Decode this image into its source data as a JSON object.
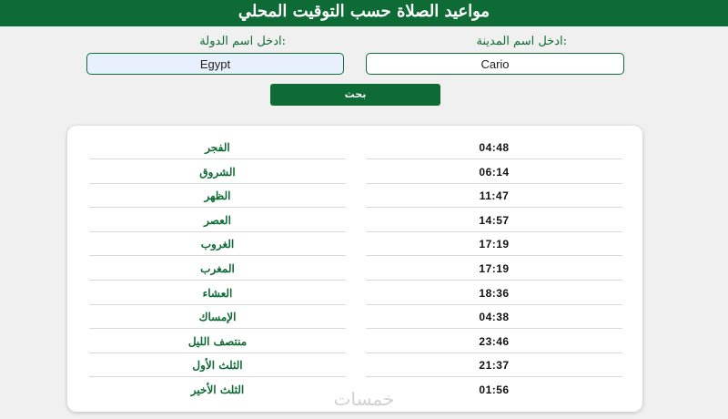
{
  "header": {
    "title": "مواعيد الصلاة حسب التوقيت المحلي"
  },
  "form": {
    "country_label": ":ادخل اسم الدولة",
    "country_value": "Egypt",
    "city_label": ":ادخل اسم المدينة",
    "city_value": "Cario",
    "search_button": "بحث"
  },
  "prayer_times": [
    {
      "name": "الفجر",
      "time": "04:48"
    },
    {
      "name": "الشروق",
      "time": "06:14"
    },
    {
      "name": "الظهر",
      "time": "11:47"
    },
    {
      "name": "العصر",
      "time": "14:57"
    },
    {
      "name": "الغروب",
      "time": "17:19"
    },
    {
      "name": "المغرب",
      "time": "17:19"
    },
    {
      "name": "العشاء",
      "time": "18:36"
    },
    {
      "name": "الإمساك",
      "time": "04:38"
    },
    {
      "name": "منتصف الليل",
      "time": "23:46"
    },
    {
      "name": "الثلث الأول",
      "time": "21:37"
    },
    {
      "name": "الثلث الأخير",
      "time": "01:56"
    }
  ],
  "watermark": "خمسات",
  "colors": {
    "brand": "#0f6b35",
    "background": "#f0f0f0",
    "card": "#ffffff"
  }
}
